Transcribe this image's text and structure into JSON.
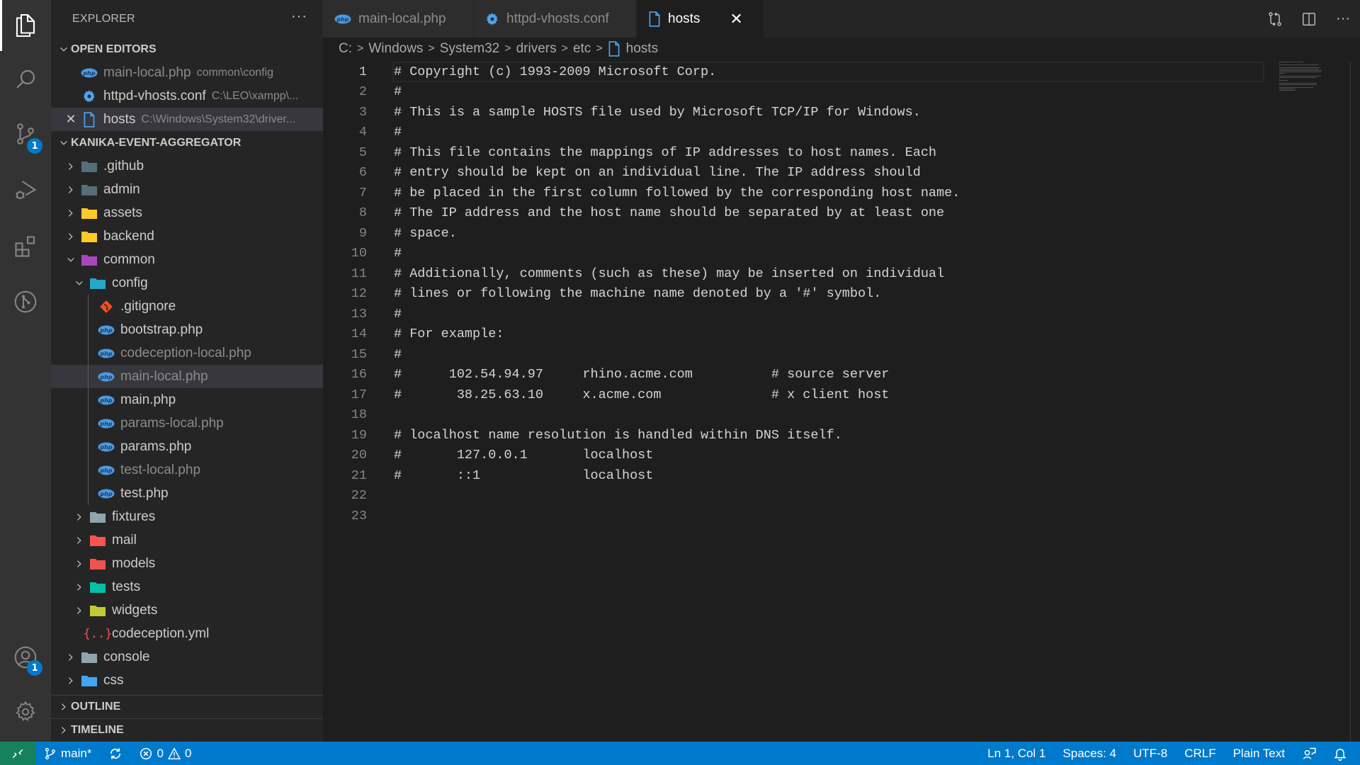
{
  "activity_bar": {
    "items": [
      {
        "name": "explorer",
        "icon": "files-icon",
        "active": true
      },
      {
        "name": "search",
        "icon": "search-icon"
      },
      {
        "name": "source-control",
        "icon": "source-control-icon",
        "badge": "1"
      },
      {
        "name": "run-debug",
        "icon": "run-debug-icon"
      },
      {
        "name": "extensions",
        "icon": "extensions-icon"
      },
      {
        "name": "gitlens",
        "icon": "gitlens-icon"
      }
    ],
    "bottom": [
      {
        "name": "accounts",
        "icon": "account-icon",
        "badge": "1"
      },
      {
        "name": "manage",
        "icon": "gear-icon"
      }
    ]
  },
  "sidebar": {
    "title": "EXPLORER",
    "more": "···",
    "open_editors": {
      "title": "OPEN EDITORS",
      "items": [
        {
          "name": "main-local.php",
          "desc": "common\\config",
          "icon": "php",
          "dim": true
        },
        {
          "name": "httpd-vhosts.conf",
          "desc": "C:\\LEO\\xampp\\...",
          "icon": "gear"
        },
        {
          "name": "hosts",
          "desc": "C:\\Windows\\System32\\driver...",
          "icon": "file",
          "active": true
        }
      ]
    },
    "project": {
      "title": "KANIKA-EVENT-AGGREGATOR",
      "tree": [
        {
          "name": ".github",
          "type": "folder",
          "depth": 0,
          "expanded": false,
          "color": "#546e7a"
        },
        {
          "name": "admin",
          "type": "folder",
          "depth": 0,
          "expanded": false,
          "color": "#546e7a"
        },
        {
          "name": "assets",
          "type": "folder",
          "depth": 0,
          "expanded": false,
          "color": "#ffca28"
        },
        {
          "name": "backend",
          "type": "folder",
          "depth": 0,
          "expanded": false,
          "color": "#ffca28"
        },
        {
          "name": "common",
          "type": "folder",
          "depth": 0,
          "expanded": true,
          "color": "#ab47bc"
        },
        {
          "name": "config",
          "type": "folder",
          "depth": 1,
          "expanded": true,
          "color": "#26a6c9"
        },
        {
          "name": ".gitignore",
          "type": "git",
          "depth": 2
        },
        {
          "name": "bootstrap.php",
          "type": "php",
          "depth": 2
        },
        {
          "name": "codeception-local.php",
          "type": "php",
          "depth": 2,
          "dim": true
        },
        {
          "name": "main-local.php",
          "type": "php",
          "depth": 2,
          "dim": true,
          "selected": true
        },
        {
          "name": "main.php",
          "type": "php",
          "depth": 2
        },
        {
          "name": "params-local.php",
          "type": "php",
          "depth": 2,
          "dim": true
        },
        {
          "name": "params.php",
          "type": "php",
          "depth": 2
        },
        {
          "name": "test-local.php",
          "type": "php",
          "depth": 2,
          "dim": true
        },
        {
          "name": "test.php",
          "type": "php",
          "depth": 2
        },
        {
          "name": "fixtures",
          "type": "folder",
          "depth": 1,
          "expanded": false,
          "color": "#90a4ae"
        },
        {
          "name": "mail",
          "type": "folder",
          "depth": 1,
          "expanded": false,
          "color": "#ff5252"
        },
        {
          "name": "models",
          "type": "folder",
          "depth": 1,
          "expanded": false,
          "color": "#ef5350"
        },
        {
          "name": "tests",
          "type": "folder",
          "depth": 1,
          "expanded": false,
          "color": "#00bfa5"
        },
        {
          "name": "widgets",
          "type": "folder",
          "depth": 1,
          "expanded": false,
          "color": "#c0ca33"
        },
        {
          "name": "codeception.yml",
          "type": "yml",
          "depth": 1
        },
        {
          "name": "console",
          "type": "folder",
          "depth": 0,
          "expanded": false,
          "color": "#90a4ae"
        },
        {
          "name": "css",
          "type": "folder",
          "depth": 0,
          "expanded": false,
          "color": "#42a5f5"
        }
      ]
    },
    "outline": "OUTLINE",
    "timeline": "TIMELINE"
  },
  "tabs": [
    {
      "label": "main-local.php",
      "icon": "php"
    },
    {
      "label": "httpd-vhosts.conf",
      "icon": "gear"
    },
    {
      "label": "hosts",
      "icon": "file",
      "active": true,
      "close": "✕"
    }
  ],
  "breadcrumb": [
    "C:",
    "Windows",
    "System32",
    "drivers",
    "etc",
    "hosts"
  ],
  "editor": {
    "current_line": 1,
    "lines": [
      "# Copyright (c) 1993-2009 Microsoft Corp.",
      "#",
      "# This is a sample HOSTS file used by Microsoft TCP/IP for Windows.",
      "#",
      "# This file contains the mappings of IP addresses to host names. Each",
      "# entry should be kept on an individual line. The IP address should",
      "# be placed in the first column followed by the corresponding host name.",
      "# The IP address and the host name should be separated by at least one",
      "# space.",
      "#",
      "# Additionally, comments (such as these) may be inserted on individual",
      "# lines or following the machine name denoted by a '#' symbol.",
      "#",
      "# For example:",
      "#",
      "#      102.54.94.97     rhino.acme.com          # source server",
      "#       38.25.63.10     x.acme.com              # x client host",
      "",
      "# localhost name resolution is handled within DNS itself.",
      "#\t127.0.0.1       localhost",
      "#\t::1             localhost",
      "",
      ""
    ]
  },
  "status_bar": {
    "branch": "main*",
    "errors": "0",
    "warnings": "0",
    "position": "Ln 1, Col 1",
    "indent": "Spaces: 4",
    "encoding": "UTF-8",
    "eol": "CRLF",
    "language": "Plain Text"
  },
  "colors": {
    "accent": "#007acc",
    "remote": "#16825d",
    "php_icon": "#4b9be0",
    "file_icon": "#4ea4f0",
    "git_icon": "#f4511e",
    "yml_icon": "#ef5350"
  }
}
